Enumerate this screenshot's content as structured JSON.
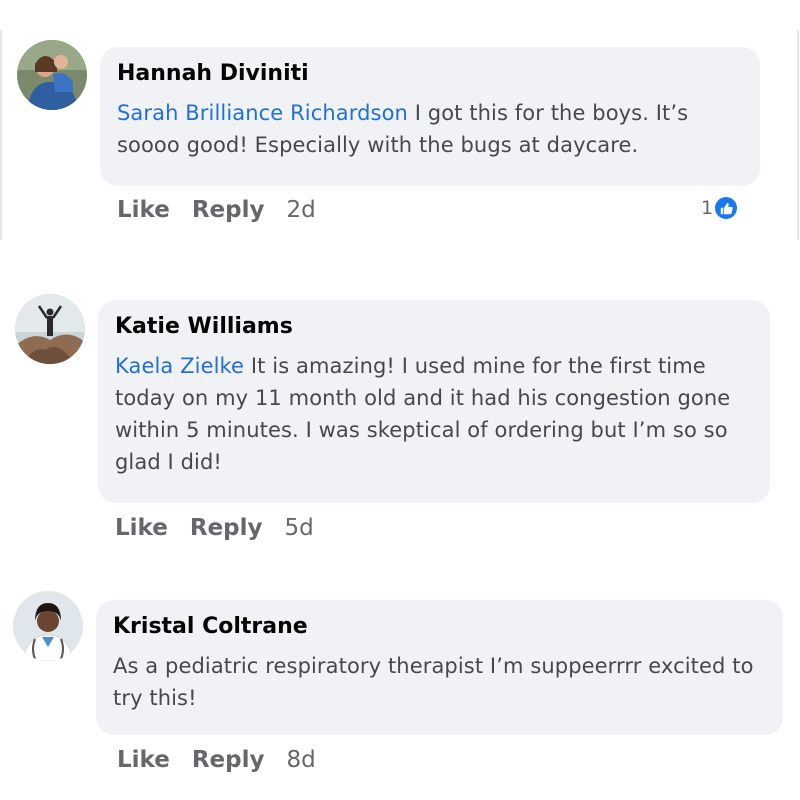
{
  "comments": [
    {
      "author": "Hannah Diviniti",
      "mention": "Sarah Brilliance Richardson",
      "text": "I got this for the boys. It’s soooo good! Especially with the bugs at daycare.",
      "like_label": "Like",
      "reply_label": "Reply",
      "time": "2d",
      "reaction_count": "1",
      "reaction_icon": "thumbs-up-icon"
    },
    {
      "author": "Katie Williams",
      "mention": "Kaela Zielke",
      "text": "It is amazing! I used mine for the first time today on my 11 month old and it had his congestion gone within 5 minutes. I was skeptical of ordering but I’m so so glad I did!",
      "like_label": "Like",
      "reply_label": "Reply",
      "time": "5d"
    },
    {
      "author": "Kristal Coltrane",
      "text": "As a pediatric respiratory therapist I’m suppeerrrr excited to try this!",
      "like_label": "Like",
      "reply_label": "Reply",
      "time": "8d"
    }
  ],
  "colors": {
    "bubble": "#f0f2f5",
    "mention": "#216fdb",
    "action": "#65676b",
    "like_badge": "#1877f2"
  }
}
